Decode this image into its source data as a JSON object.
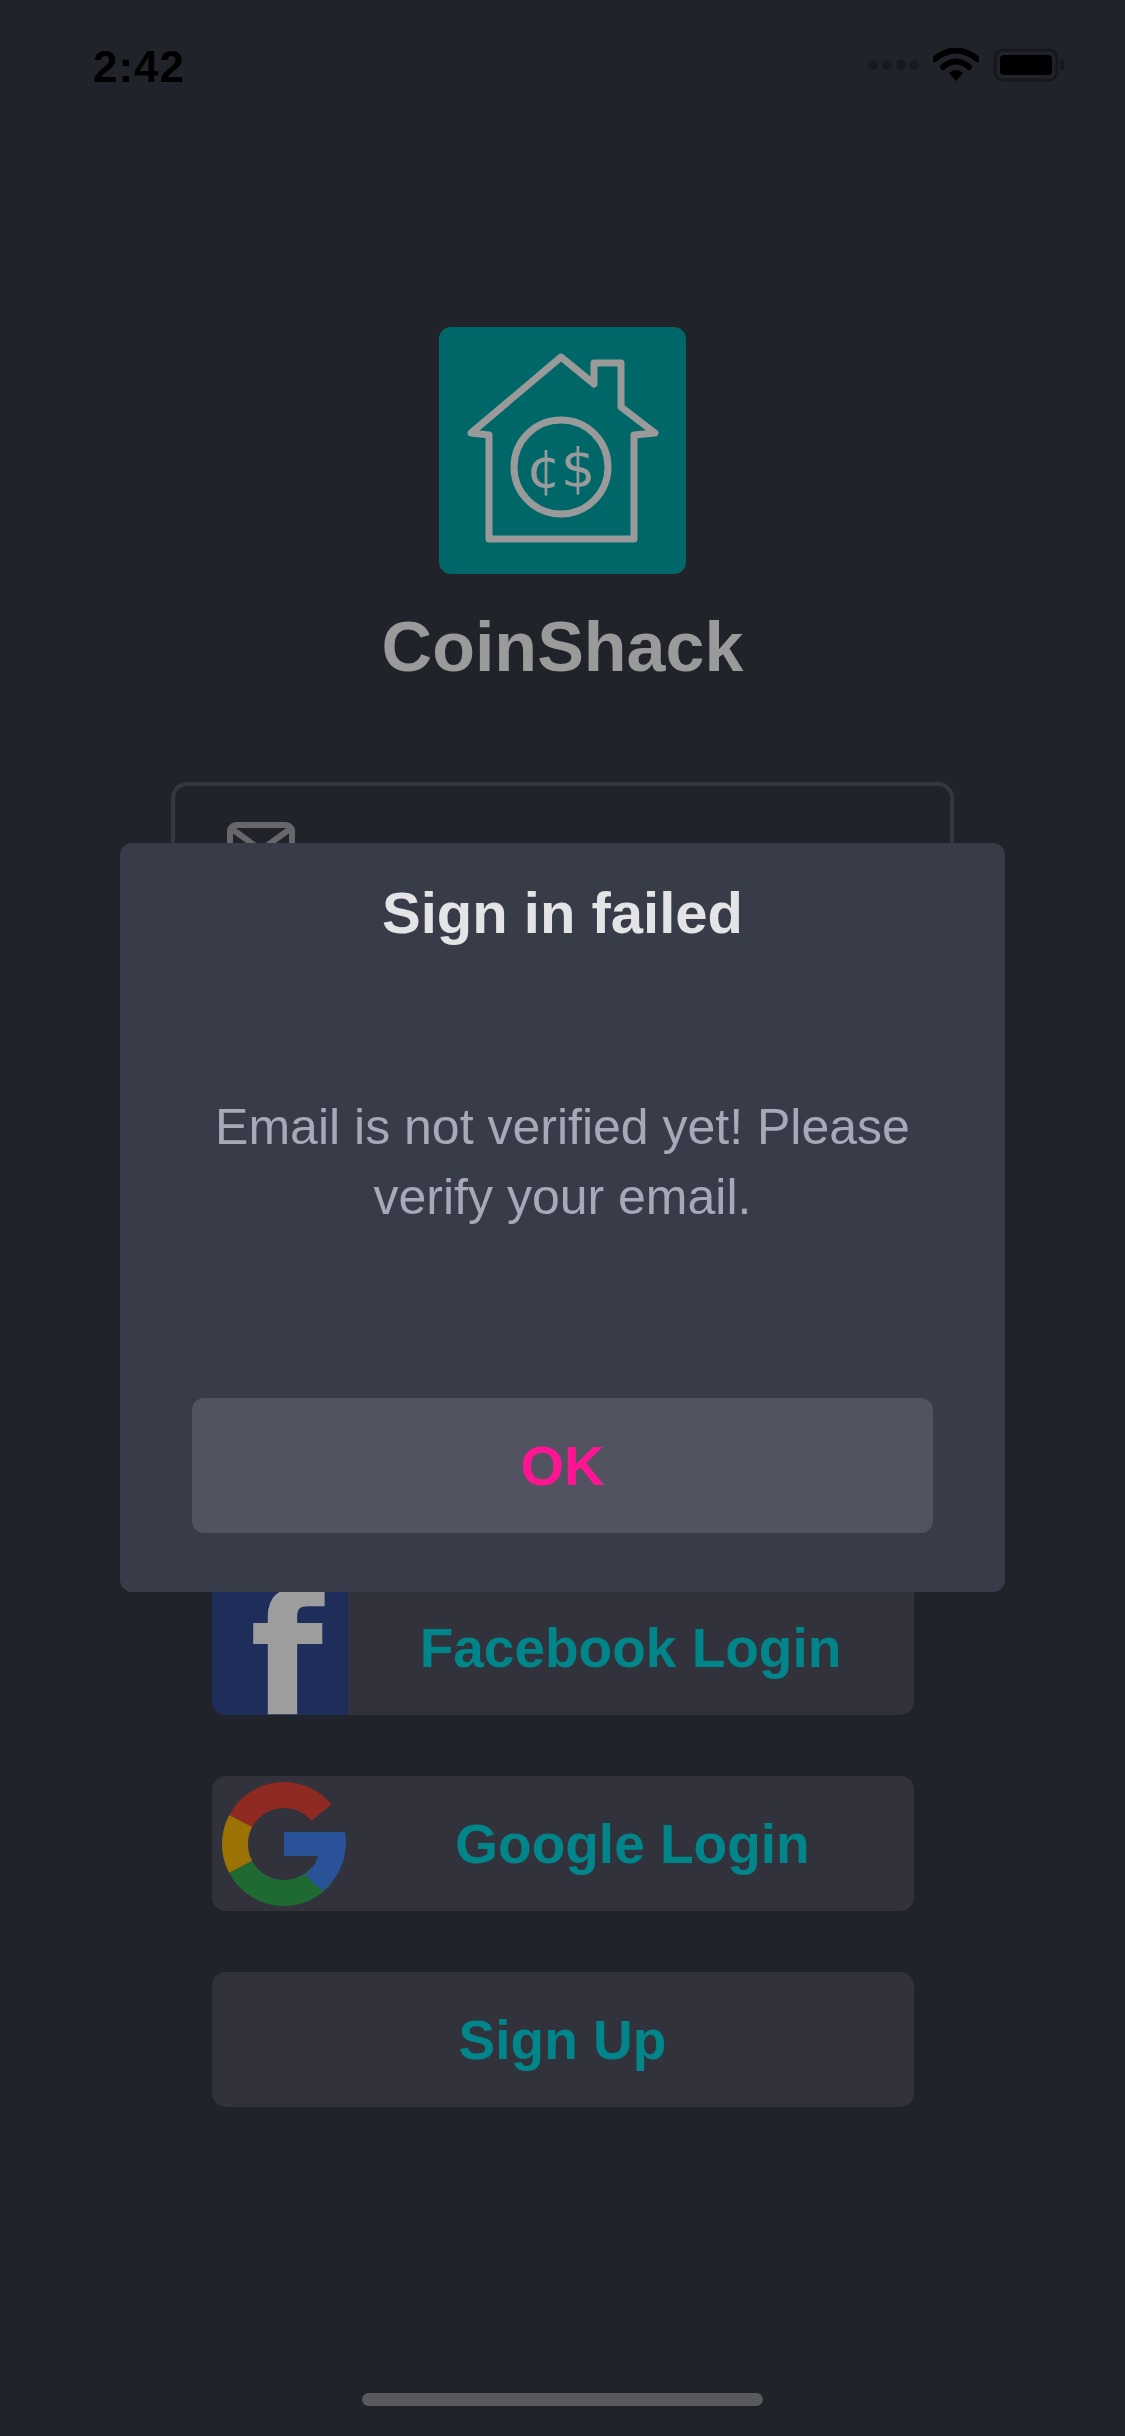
{
  "status_bar": {
    "time": "2:42"
  },
  "app": {
    "logo_glyph": "¢$",
    "name": "CoinShack"
  },
  "social_buttons": [
    {
      "kind": "facebook",
      "icon_glyph": "f",
      "label": "Facebook Login"
    },
    {
      "kind": "google",
      "label": "Google Login"
    },
    {
      "kind": "plain",
      "label": "Sign Up"
    }
  ],
  "alert": {
    "title": "Sign in failed",
    "message": "Email is not verified yet! Please verify your email.",
    "buttons": [
      "OK"
    ]
  }
}
